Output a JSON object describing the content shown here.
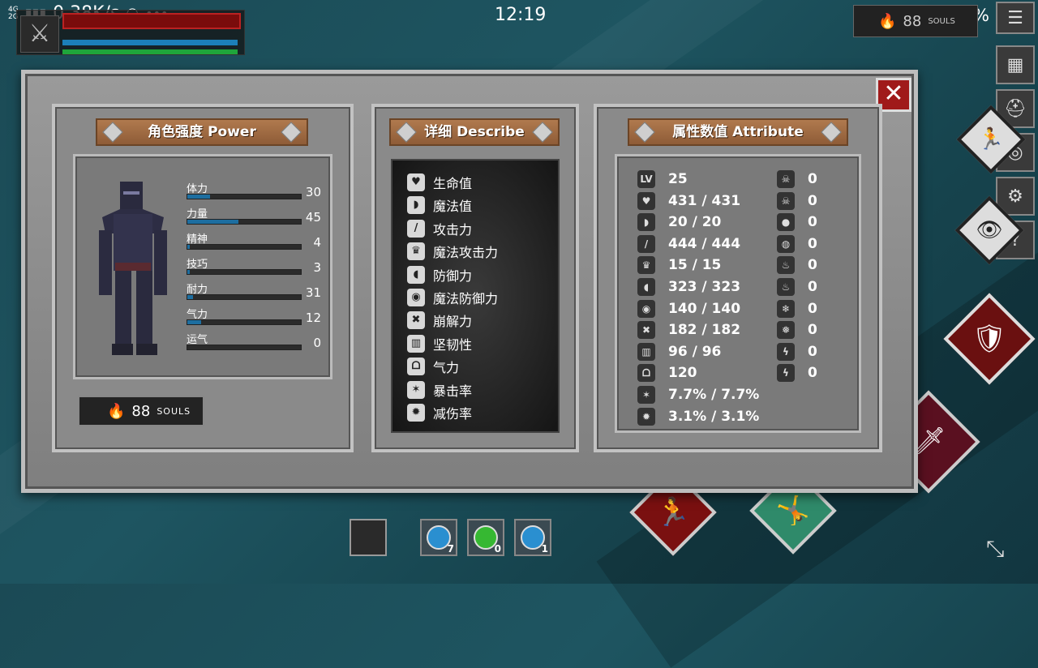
{
  "statusbar": {
    "network": "4G\n2G",
    "speed": "0.38K/s",
    "time": "12:19",
    "battery": "69%"
  },
  "hud": {
    "souls_count": "88",
    "souls_label": "SOULS"
  },
  "panels": {
    "power_title": "角色强度 Power",
    "describe_title": "详细 Describe",
    "attribute_title": "属性数值 Attribute"
  },
  "power_stats": [
    {
      "name": "体力",
      "value": "30",
      "fill": 0.2
    },
    {
      "name": "力量",
      "value": "45",
      "fill": 0.45
    },
    {
      "name": "精神",
      "value": "4",
      "fill": 0.02
    },
    {
      "name": "技巧",
      "value": "3",
      "fill": 0.02
    },
    {
      "name": "耐力",
      "value": "31",
      "fill": 0.05
    },
    {
      "name": "气力",
      "value": "12",
      "fill": 0.12
    },
    {
      "name": "运气",
      "value": "0",
      "fill": 0
    }
  ],
  "souls_box": {
    "count": "88",
    "label": "SOULS"
  },
  "describe": [
    {
      "icon": "heart-icon",
      "label": "生命值"
    },
    {
      "icon": "helmet-icon",
      "label": "魔法值"
    },
    {
      "icon": "sword-icon",
      "label": "攻击力"
    },
    {
      "icon": "magic-attack-icon",
      "label": "魔法攻击力"
    },
    {
      "icon": "shield-icon",
      "label": "防御力"
    },
    {
      "icon": "magic-shield-icon",
      "label": "魔法防御力"
    },
    {
      "icon": "break-icon",
      "label": "崩解力"
    },
    {
      "icon": "knight-helmet-icon",
      "label": "坚韧性"
    },
    {
      "icon": "lungs-icon",
      "label": "气力"
    },
    {
      "icon": "crit-star-icon",
      "label": "暴击率"
    },
    {
      "icon": "damage-reduce-icon",
      "label": "减伤率"
    }
  ],
  "attributes_left": [
    {
      "icon": "lv-icon",
      "icon_text": "LV",
      "value": "25"
    },
    {
      "icon": "heart-icon",
      "value": "431 / 431"
    },
    {
      "icon": "helmet-icon",
      "value": "20 / 20"
    },
    {
      "icon": "sword-icon",
      "value": "444 / 444"
    },
    {
      "icon": "magic-attack-icon",
      "value": "15 / 15"
    },
    {
      "icon": "shield-icon",
      "value": "323 / 323"
    },
    {
      "icon": "magic-shield-icon",
      "value": "140 / 140"
    },
    {
      "icon": "break-icon",
      "value": "182 / 182"
    },
    {
      "icon": "knight-helmet-icon",
      "value": "96 / 96"
    },
    {
      "icon": "lungs-icon",
      "value": "120"
    },
    {
      "icon": "crit-star-icon",
      "value": "7.7% / 7.7%"
    },
    {
      "icon": "damage-reduce-icon",
      "value": "3.1% / 3.1%"
    }
  ],
  "attributes_right": [
    {
      "icon": "poison-skull-icon",
      "value": "0"
    },
    {
      "icon": "poison-resist-icon",
      "value": "0"
    },
    {
      "icon": "bleed-drop-icon",
      "value": "0"
    },
    {
      "icon": "bleed-resist-icon",
      "value": "0"
    },
    {
      "icon": "fire-icon",
      "value": "0"
    },
    {
      "icon": "fire-resist-icon",
      "value": "0"
    },
    {
      "icon": "frost-icon",
      "value": "0"
    },
    {
      "icon": "frost-resist-icon",
      "value": "0"
    },
    {
      "icon": "lightning-icon",
      "value": "0"
    },
    {
      "icon": "lightning-resist-icon",
      "value": "0"
    }
  ],
  "potions": [
    {
      "color": "#2a8fd0",
      "count": "7"
    },
    {
      "color": "#36b832",
      "count": "0"
    },
    {
      "color": "#2a8fd0",
      "count": "1"
    }
  ],
  "colors": {
    "hp": "#7a0c0c",
    "mp": "#1c7fb8",
    "stamina": "#1fa53b",
    "plank": "#a06d43",
    "close": "#a01a1a"
  }
}
